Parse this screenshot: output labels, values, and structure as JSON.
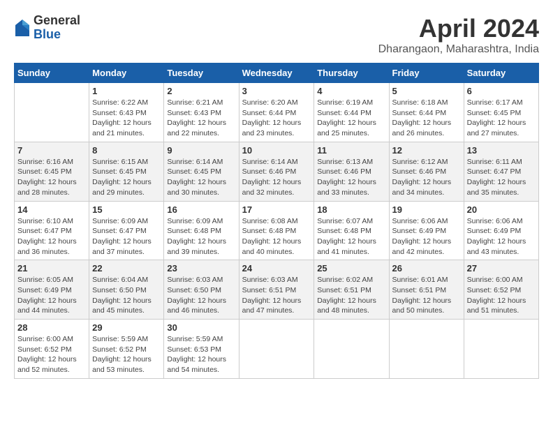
{
  "logo": {
    "general": "General",
    "blue": "Blue"
  },
  "title": "April 2024",
  "subtitle": "Dharangaon, Maharashtra, India",
  "days": [
    "Sunday",
    "Monday",
    "Tuesday",
    "Wednesday",
    "Thursday",
    "Friday",
    "Saturday"
  ],
  "weeks": [
    [
      {
        "day": "",
        "info": ""
      },
      {
        "day": "1",
        "info": "Sunrise: 6:22 AM\nSunset: 6:43 PM\nDaylight: 12 hours\nand 21 minutes."
      },
      {
        "day": "2",
        "info": "Sunrise: 6:21 AM\nSunset: 6:43 PM\nDaylight: 12 hours\nand 22 minutes."
      },
      {
        "day": "3",
        "info": "Sunrise: 6:20 AM\nSunset: 6:44 PM\nDaylight: 12 hours\nand 23 minutes."
      },
      {
        "day": "4",
        "info": "Sunrise: 6:19 AM\nSunset: 6:44 PM\nDaylight: 12 hours\nand 25 minutes."
      },
      {
        "day": "5",
        "info": "Sunrise: 6:18 AM\nSunset: 6:44 PM\nDaylight: 12 hours\nand 26 minutes."
      },
      {
        "day": "6",
        "info": "Sunrise: 6:17 AM\nSunset: 6:45 PM\nDaylight: 12 hours\nand 27 minutes."
      }
    ],
    [
      {
        "day": "7",
        "info": "Sunrise: 6:16 AM\nSunset: 6:45 PM\nDaylight: 12 hours\nand 28 minutes."
      },
      {
        "day": "8",
        "info": "Sunrise: 6:15 AM\nSunset: 6:45 PM\nDaylight: 12 hours\nand 29 minutes."
      },
      {
        "day": "9",
        "info": "Sunrise: 6:14 AM\nSunset: 6:45 PM\nDaylight: 12 hours\nand 30 minutes."
      },
      {
        "day": "10",
        "info": "Sunrise: 6:14 AM\nSunset: 6:46 PM\nDaylight: 12 hours\nand 32 minutes."
      },
      {
        "day": "11",
        "info": "Sunrise: 6:13 AM\nSunset: 6:46 PM\nDaylight: 12 hours\nand 33 minutes."
      },
      {
        "day": "12",
        "info": "Sunrise: 6:12 AM\nSunset: 6:46 PM\nDaylight: 12 hours\nand 34 minutes."
      },
      {
        "day": "13",
        "info": "Sunrise: 6:11 AM\nSunset: 6:47 PM\nDaylight: 12 hours\nand 35 minutes."
      }
    ],
    [
      {
        "day": "14",
        "info": "Sunrise: 6:10 AM\nSunset: 6:47 PM\nDaylight: 12 hours\nand 36 minutes."
      },
      {
        "day": "15",
        "info": "Sunrise: 6:09 AM\nSunset: 6:47 PM\nDaylight: 12 hours\nand 37 minutes."
      },
      {
        "day": "16",
        "info": "Sunrise: 6:09 AM\nSunset: 6:48 PM\nDaylight: 12 hours\nand 39 minutes."
      },
      {
        "day": "17",
        "info": "Sunrise: 6:08 AM\nSunset: 6:48 PM\nDaylight: 12 hours\nand 40 minutes."
      },
      {
        "day": "18",
        "info": "Sunrise: 6:07 AM\nSunset: 6:48 PM\nDaylight: 12 hours\nand 41 minutes."
      },
      {
        "day": "19",
        "info": "Sunrise: 6:06 AM\nSunset: 6:49 PM\nDaylight: 12 hours\nand 42 minutes."
      },
      {
        "day": "20",
        "info": "Sunrise: 6:06 AM\nSunset: 6:49 PM\nDaylight: 12 hours\nand 43 minutes."
      }
    ],
    [
      {
        "day": "21",
        "info": "Sunrise: 6:05 AM\nSunset: 6:49 PM\nDaylight: 12 hours\nand 44 minutes."
      },
      {
        "day": "22",
        "info": "Sunrise: 6:04 AM\nSunset: 6:50 PM\nDaylight: 12 hours\nand 45 minutes."
      },
      {
        "day": "23",
        "info": "Sunrise: 6:03 AM\nSunset: 6:50 PM\nDaylight: 12 hours\nand 46 minutes."
      },
      {
        "day": "24",
        "info": "Sunrise: 6:03 AM\nSunset: 6:51 PM\nDaylight: 12 hours\nand 47 minutes."
      },
      {
        "day": "25",
        "info": "Sunrise: 6:02 AM\nSunset: 6:51 PM\nDaylight: 12 hours\nand 48 minutes."
      },
      {
        "day": "26",
        "info": "Sunrise: 6:01 AM\nSunset: 6:51 PM\nDaylight: 12 hours\nand 50 minutes."
      },
      {
        "day": "27",
        "info": "Sunrise: 6:00 AM\nSunset: 6:52 PM\nDaylight: 12 hours\nand 51 minutes."
      }
    ],
    [
      {
        "day": "28",
        "info": "Sunrise: 6:00 AM\nSunset: 6:52 PM\nDaylight: 12 hours\nand 52 minutes."
      },
      {
        "day": "29",
        "info": "Sunrise: 5:59 AM\nSunset: 6:52 PM\nDaylight: 12 hours\nand 53 minutes."
      },
      {
        "day": "30",
        "info": "Sunrise: 5:59 AM\nSunset: 6:53 PM\nDaylight: 12 hours\nand 54 minutes."
      },
      {
        "day": "",
        "info": ""
      },
      {
        "day": "",
        "info": ""
      },
      {
        "day": "",
        "info": ""
      },
      {
        "day": "",
        "info": ""
      }
    ]
  ]
}
